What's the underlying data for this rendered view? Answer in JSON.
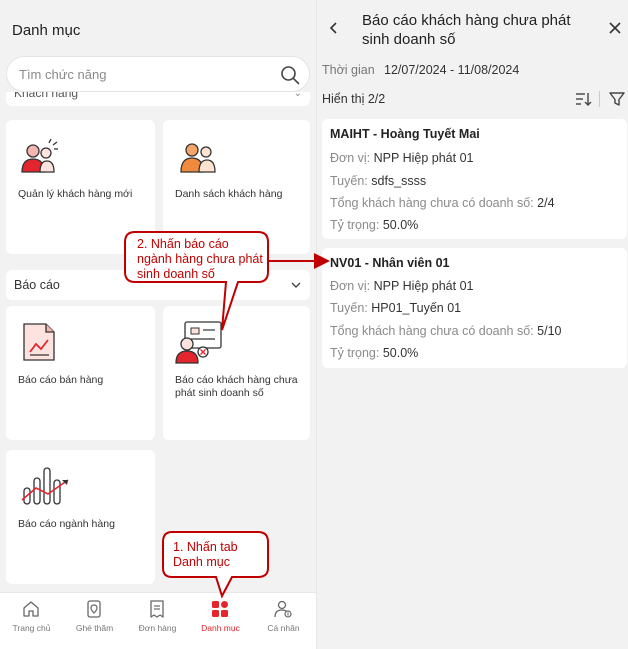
{
  "left_panel": {
    "title": "Danh mục",
    "search_placeholder": "Tìm chức năng",
    "peek_section_label": "Khách hàng",
    "customer_cards": [
      {
        "label": "Quản lý khách hàng mới",
        "icon": "customer-management-icon"
      },
      {
        "label": "Danh sách khách hàng",
        "icon": "customer-list-icon"
      }
    ],
    "report_section_label": "Báo cáo",
    "report_cards": [
      {
        "label": "Báo cáo bán hàng",
        "icon": "sales-report-icon"
      },
      {
        "label": "Báo cáo khách hàng chưa phát sinh doanh số",
        "icon": "customer-no-revenue-icon"
      },
      {
        "label": "Báo cáo ngành hàng",
        "icon": "industry-report-icon"
      }
    ]
  },
  "tabbar": {
    "tabs": [
      {
        "label": "Trang chủ",
        "icon": "home-icon",
        "active": false
      },
      {
        "label": "Ghé thăm",
        "icon": "visit-icon",
        "active": false
      },
      {
        "label": "Đơn hàng",
        "icon": "order-icon",
        "active": false
      },
      {
        "label": "Danh mục",
        "icon": "category-grid-icon",
        "active": true
      },
      {
        "label": "Cá nhân",
        "icon": "profile-icon",
        "active": false
      }
    ]
  },
  "right_panel": {
    "title": "Báo cáo khách hàng chưa phát sinh doanh số",
    "time_label": "Thời gian",
    "time_value": "12/07/2024 - 11/08/2024",
    "shown_label": "Hiển thị 2/2",
    "records": [
      {
        "name": "MAIHT - Hoàng Tuyết Mai",
        "unit_key": "Đơn vị:",
        "unit_val": "NPP Hiệp phát 01",
        "route_key": "Tuyến:",
        "route_val": "sdfs_ssss",
        "total_key": "Tổng khách hàng chưa có doanh số:",
        "total_val": "2/4",
        "ratio_key": "Tỷ trọng:",
        "ratio_val": "50.0%"
      },
      {
        "name": "NV01 - Nhân viên 01",
        "unit_key": "Đơn vị:",
        "unit_val": "NPP Hiệp phát 01",
        "route_key": "Tuyến:",
        "route_val": "HP01_Tuyến 01",
        "total_key": "Tổng khách hàng chưa có doanh số:",
        "total_val": "5/10",
        "ratio_key": "Tỷ trọng:",
        "ratio_val": "50.0%"
      }
    ]
  },
  "callouts": {
    "step1": "1. Nhấn tab Danh mục",
    "step2": "2. Nhấn báo cáo ngành hàng chưa phát sinh doanh số"
  },
  "colors": {
    "accent": "#e3262d",
    "callout": "#c00000",
    "bg": "#f2f2f2"
  }
}
